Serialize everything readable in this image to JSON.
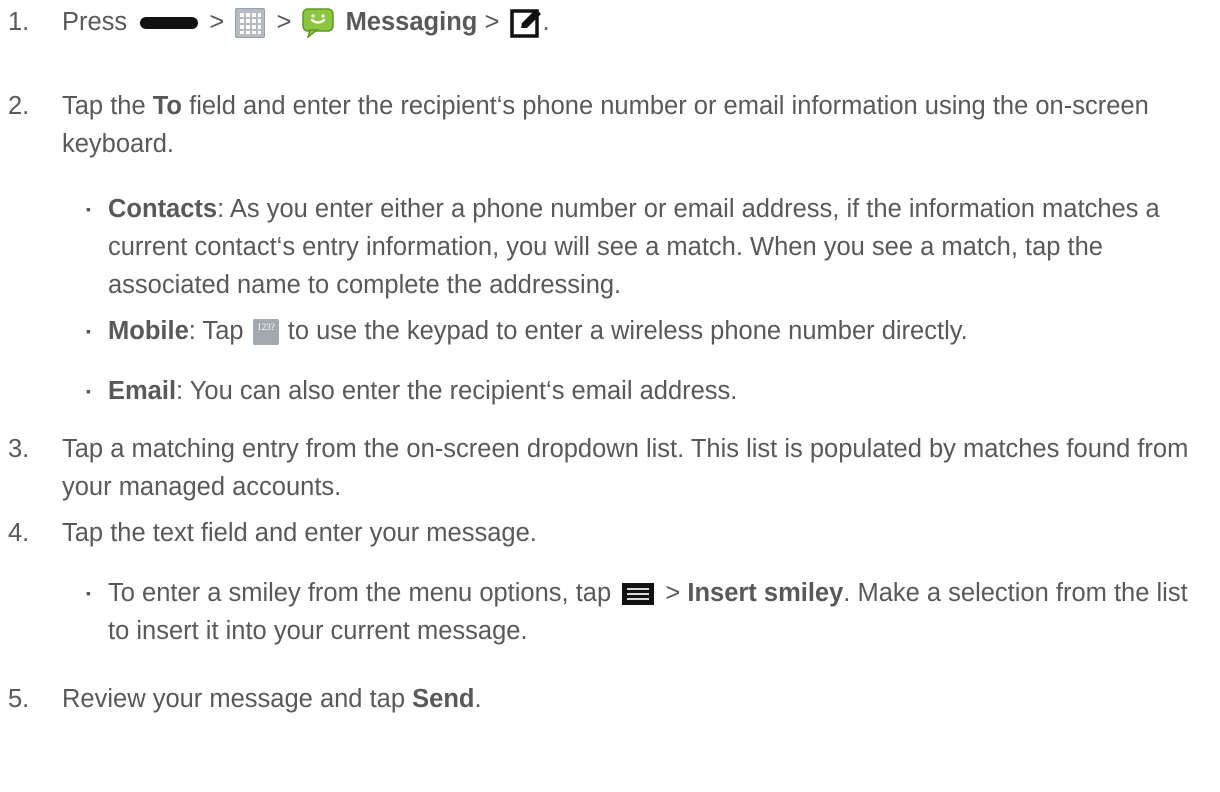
{
  "steps": [
    {
      "num": "1.",
      "press": "Press",
      "sep1": ">",
      "sep2": ">",
      "messaging": "Messaging",
      "sep3": ">",
      "end": "."
    },
    {
      "num": "2.",
      "t1": "Tap the",
      "to": "To",
      "t2": "field and enter the recipient‘s phone number or email information using the on-screen keyboard.",
      "bullets": [
        {
          "label": "Contacts",
          "text": ": As you enter either a phone number or email address, if the information matches a current contact‘s entry information, you will see a match. When you see a match, tap the associated name to complete the addressing."
        },
        {
          "label": "Mobile",
          "pre": ": Tap",
          "icon_text": "123?",
          "post": "to use the keypad to enter a wireless phone number directly."
        },
        {
          "label": "Email",
          "text": ": You can also enter the recipient‘s email address."
        }
      ]
    },
    {
      "num": "3.",
      "text": "Tap a matching entry from the on-screen dropdown list. This list is populated by matches found from your managed accounts."
    },
    {
      "num": "4.",
      "text": "Tap the text field and enter your message.",
      "bullets": [
        {
          "pre": "To enter a smiley from the menu options, tap",
          "sep": ">",
          "label": "Insert smiley",
          "post": ". Make a selection from the list to insert it into your current message."
        }
      ]
    },
    {
      "num": "5.",
      "pre": "Review your message and tap",
      "label": "Send",
      "end": "."
    }
  ],
  "bullet_char": "▪",
  "icons": [
    "home-key-icon",
    "apps-grid-icon",
    "messaging-app-icon",
    "compose-icon",
    "keypad-123-icon",
    "menu-icon"
  ],
  "colors": {
    "text": "#58595b",
    "icon_dark": "#111111",
    "messaging_green": "#8cc63f"
  }
}
